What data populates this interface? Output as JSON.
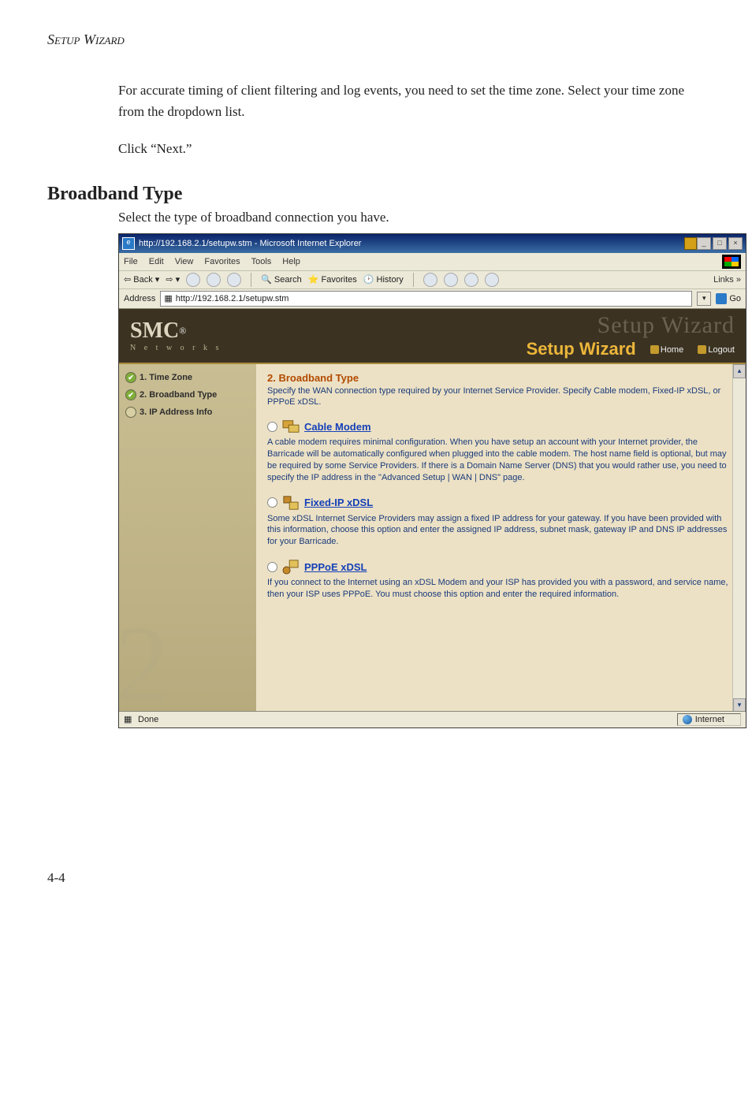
{
  "page_header": {
    "setup": "Setup ",
    "wizard": "Wizard"
  },
  "intro_paragraph_1": "For accurate timing of client filtering and log events, you need to set the time zone. Select your time zone from the dropdown list.",
  "intro_paragraph_2": "Click “Next.”",
  "section_heading": "Broadband Type",
  "section_sub": "Select the type of broadband connection you have.",
  "browser": {
    "title": "http://192.168.2.1/setupw.stm - Microsoft Internet Explorer",
    "menu": [
      "File",
      "Edit",
      "View",
      "Favorites",
      "Tools",
      "Help"
    ],
    "toolbar": {
      "back": "Back",
      "search": "Search",
      "favorites": "Favorites",
      "history": "History",
      "links_label": "Links"
    },
    "address_label": "Address",
    "address_value": "http://192.168.2.1/setupw.stm",
    "go_label": "Go",
    "status_done": "Done",
    "status_zone": "Internet"
  },
  "banner": {
    "logo": "SMC",
    "reg": "®",
    "logo_sub": "N e t w o r k s",
    "ghost": "Setup Wizard",
    "wizard_label": "Setup Wizard",
    "home": "Home",
    "logout": "Logout"
  },
  "sidebar": {
    "steps": [
      {
        "label": "1. Time Zone",
        "state": "done"
      },
      {
        "label": "2. Broadband Type",
        "state": "done"
      },
      {
        "label": "3. IP Address Info",
        "state": "pending"
      }
    ],
    "bignum": "2"
  },
  "main": {
    "title": "2. Broadband Type",
    "desc": "Specify the WAN connection type required by your Internet Service Provider. Specify Cable modem, Fixed-IP xDSL, or PPPoE xDSL.",
    "options": [
      {
        "label": "Cable Modem",
        "body": "A cable modem requires minimal configuration. When you have setup an account with your Internet provider, the Barricade will be automatically configured when plugged into the cable modem. The host name field is optional, but may be required by some Service Providers. If there is a Domain Name Server (DNS) that you would rather use, you need to specify the IP address in the \"Advanced Setup | WAN | DNS\" page."
      },
      {
        "label": "Fixed-IP xDSL",
        "body": "Some xDSL Internet Service Providers may assign a fixed IP address for your gateway. If you have been provided with this information, choose this option and enter the assigned IP address, subnet mask, gateway IP and DNS IP addresses for your Barricade."
      },
      {
        "label": "PPPoE xDSL",
        "body": "If you connect to the Internet using an xDSL Modem and your ISP has provided you with a password, and service name, then your ISP uses PPPoE. You must choose this option and enter the required information."
      }
    ]
  },
  "page_number": "4-4"
}
